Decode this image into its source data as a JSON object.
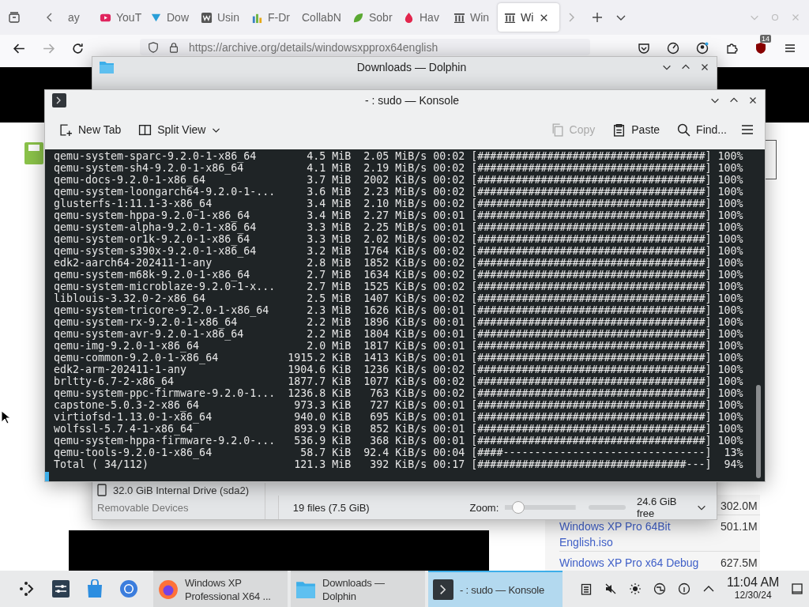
{
  "browser": {
    "tabs": [
      {
        "label": "ay",
        "kind": "plain",
        "selected": false
      },
      {
        "label": "YouT",
        "kind": "video",
        "selected": false
      },
      {
        "label": "Dow",
        "kind": "download",
        "selected": false
      },
      {
        "label": "Usin",
        "kind": "wiki",
        "selected": false
      },
      {
        "label": "F-Dr",
        "kind": "chart",
        "selected": false
      },
      {
        "label": "CollabN",
        "kind": "none",
        "selected": false
      },
      {
        "label": "Sobr",
        "kind": "leaf",
        "selected": false
      },
      {
        "label": "Hav",
        "kind": "drop",
        "selected": false
      },
      {
        "label": "Win",
        "kind": "archive",
        "selected": false
      },
      {
        "label": "Wi",
        "kind": "archive",
        "selected": true
      }
    ],
    "url": "https://archive.org/details/windowsxpprox64english",
    "badge": "14"
  },
  "webpage": {
    "files": [
      {
        "size": "302.0M"
      },
      {
        "name": "Windows XP Pro 64Bit English.iso",
        "size": "501.1M"
      },
      {
        "name": "Windows XP Pro x64 Debug",
        "size": "627.5M"
      }
    ]
  },
  "dolphin": {
    "title": "Downloads — Dolphin",
    "drive": "32.0 GiB Internal Drive (sda2)",
    "places_heading": "Removable Devices",
    "status": "19 files (7.5 GiB)",
    "zoom_label": "Zoom:",
    "zoom": {
      "level": 0.12
    },
    "free": "24.6 GiB free"
  },
  "konsole": {
    "title": "- : sudo — Konsole",
    "toolbar": [
      {
        "label": "New Tab",
        "kind": "newtab",
        "disabled": false
      },
      {
        "label": "Split View",
        "kind": "split",
        "disabled": false
      },
      {
        "label": "Copy",
        "kind": "copy",
        "disabled": true
      },
      {
        "label": "Paste",
        "kind": "paste",
        "disabled": false
      },
      {
        "label": "Find...",
        "kind": "find",
        "disabled": false
      }
    ],
    "lines": [
      {
        "name": "qemu-system-sparc-9.2.0-1-x86_64",
        "size": "4.5 MiB",
        "rate": "2.05 MiB/s",
        "eta": "00:02",
        "bar": "[####################################]",
        "percent": "100%"
      },
      {
        "name": "qemu-system-sh4-9.2.0-1-x86_64",
        "size": "4.1 MiB",
        "rate": "2.19 MiB/s",
        "eta": "00:02",
        "bar": "[####################################]",
        "percent": "100%"
      },
      {
        "name": "qemu-docs-9.2.0-1-x86_64",
        "size": "3.7 MiB",
        "rate": "2002 KiB/s",
        "eta": "00:02",
        "bar": "[####################################]",
        "percent": "100%"
      },
      {
        "name": "qemu-system-loongarch64-9.2.0-1-...",
        "size": "3.6 MiB",
        "rate": "2.23 MiB/s",
        "eta": "00:02",
        "bar": "[####################################]",
        "percent": "100%"
      },
      {
        "name": "glusterfs-1:11.1-3-x86_64",
        "size": "3.4 MiB",
        "rate": "2.10 MiB/s",
        "eta": "00:02",
        "bar": "[####################################]",
        "percent": "100%"
      },
      {
        "name": "qemu-system-hppa-9.2.0-1-x86_64",
        "size": "3.4 MiB",
        "rate": "2.27 MiB/s",
        "eta": "00:01",
        "bar": "[####################################]",
        "percent": "100%"
      },
      {
        "name": "qemu-system-alpha-9.2.0-1-x86_64",
        "size": "3.3 MiB",
        "rate": "2.25 MiB/s",
        "eta": "00:01",
        "bar": "[####################################]",
        "percent": "100%"
      },
      {
        "name": "qemu-system-or1k-9.2.0-1-x86_64",
        "size": "3.3 MiB",
        "rate": "2.02 MiB/s",
        "eta": "00:02",
        "bar": "[####################################]",
        "percent": "100%"
      },
      {
        "name": "qemu-system-s390x-9.2.0-1-x86_64",
        "size": "3.2 MiB",
        "rate": "1764 KiB/s",
        "eta": "00:02",
        "bar": "[####################################]",
        "percent": "100%"
      },
      {
        "name": "edk2-aarch64-202411-1-any",
        "size": "2.8 MiB",
        "rate": "1852 KiB/s",
        "eta": "00:02",
        "bar": "[####################################]",
        "percent": "100%"
      },
      {
        "name": "qemu-system-m68k-9.2.0-1-x86_64",
        "size": "2.7 MiB",
        "rate": "1634 KiB/s",
        "eta": "00:02",
        "bar": "[####################################]",
        "percent": "100%"
      },
      {
        "name": "qemu-system-microblaze-9.2.0-1-x...",
        "size": "2.7 MiB",
        "rate": "1525 KiB/s",
        "eta": "00:02",
        "bar": "[####################################]",
        "percent": "100%"
      },
      {
        "name": "liblouis-3.32.0-2-x86_64",
        "size": "2.5 MiB",
        "rate": "1407 KiB/s",
        "eta": "00:02",
        "bar": "[####################################]",
        "percent": "100%"
      },
      {
        "name": "qemu-system-tricore-9.2.0-1-x86_64",
        "size": "2.3 MiB",
        "rate": "1626 KiB/s",
        "eta": "00:01",
        "bar": "[####################################]",
        "percent": "100%"
      },
      {
        "name": "qemu-system-rx-9.2.0-1-x86_64",
        "size": "2.2 MiB",
        "rate": "1896 KiB/s",
        "eta": "00:01",
        "bar": "[####################################]",
        "percent": "100%"
      },
      {
        "name": "qemu-system-avr-9.2.0-1-x86_64",
        "size": "2.2 MiB",
        "rate": "1804 KiB/s",
        "eta": "00:01",
        "bar": "[####################################]",
        "percent": "100%"
      },
      {
        "name": "qemu-img-9.2.0-1-x86_64",
        "size": "2.0 MiB",
        "rate": "1817 KiB/s",
        "eta": "00:01",
        "bar": "[####################################]",
        "percent": "100%"
      },
      {
        "name": "qemu-common-9.2.0-1-x86_64",
        "size": "1915.2 KiB",
        "rate": "1413 KiB/s",
        "eta": "00:01",
        "bar": "[####################################]",
        "percent": "100%"
      },
      {
        "name": "edk2-arm-202411-1-any",
        "size": "1904.6 KiB",
        "rate": "1236 KiB/s",
        "eta": "00:02",
        "bar": "[####################################]",
        "percent": "100%"
      },
      {
        "name": "brltty-6.7-2-x86_64",
        "size": "1877.7 KiB",
        "rate": "1077 KiB/s",
        "eta": "00:02",
        "bar": "[####################################]",
        "percent": "100%"
      },
      {
        "name": "qemu-system-ppc-firmware-9.2.0-1...",
        "size": "1236.8 KiB",
        "rate": "763 KiB/s",
        "eta": "00:02",
        "bar": "[####################################]",
        "percent": "100%"
      },
      {
        "name": "capstone-5.0.3-2-x86_64",
        "size": "973.3 KiB",
        "rate": "727 KiB/s",
        "eta": "00:01",
        "bar": "[####################################]",
        "percent": "100%"
      },
      {
        "name": "virtiofsd-1.13.0-1-x86_64",
        "size": "940.0 KiB",
        "rate": "695 KiB/s",
        "eta": "00:01",
        "bar": "[####################################]",
        "percent": "100%"
      },
      {
        "name": "wolfssl-5.7.4-1-x86_64",
        "size": "893.9 KiB",
        "rate": "852 KiB/s",
        "eta": "00:01",
        "bar": "[####################################]",
        "percent": "100%"
      },
      {
        "name": "qemu-system-hppa-firmware-9.2.0-...",
        "size": "536.9 KiB",
        "rate": "368 KiB/s",
        "eta": "00:01",
        "bar": "[####################################]",
        "percent": "100%"
      },
      {
        "name": "qemu-tools-9.2.0-1-x86_64",
        "size": "58.7 KiB",
        "rate": "92.4 KiB/s",
        "eta": "00:04",
        "bar": "[####--------------------------------]",
        "percent": "13%"
      },
      {
        "name": "Total ( 34/112)",
        "size": "121.3 MiB",
        "rate": "392 KiB/s",
        "eta": "00:17",
        "bar": "[#################################---]",
        "percent": "94%"
      }
    ]
  },
  "taskbar": {
    "tasks": [
      {
        "title": "Windows XP Professional X64 ...",
        "kind": "firefox",
        "selected": false
      },
      {
        "title": "Downloads — Dolphin",
        "kind": "folder",
        "selected": false
      },
      {
        "title": "- : sudo — Konsole",
        "kind": "terminal",
        "selected": true
      }
    ],
    "time": "11:04 AM",
    "date": "12/30/24"
  }
}
